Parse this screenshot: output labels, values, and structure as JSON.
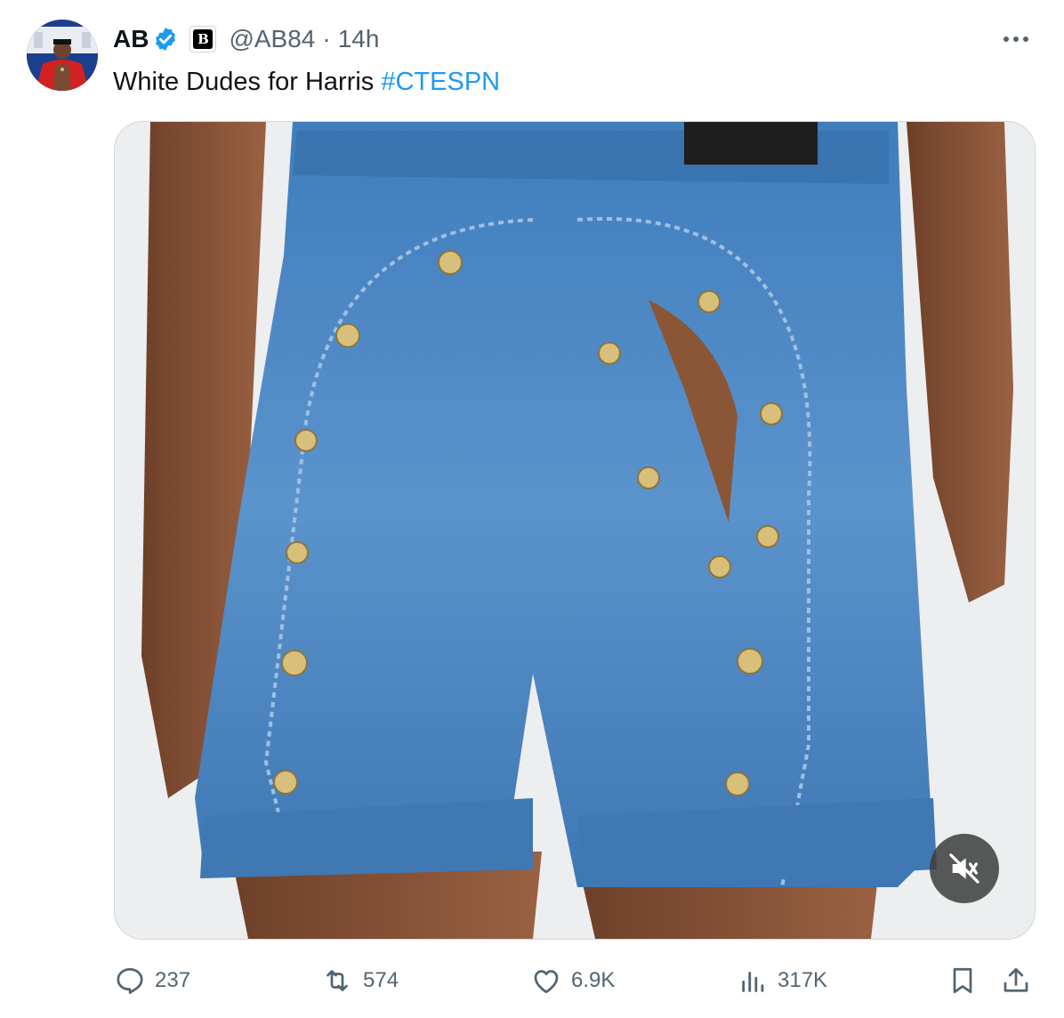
{
  "tweet": {
    "author": {
      "display_name": "AB",
      "handle": "@AB84",
      "separator": "·",
      "time": "14h",
      "avatar_icon": "avatar-image",
      "verified_icon": "verified-badge-icon",
      "affiliation_icon": "affiliation-badge-icon",
      "affiliation_label": "B"
    },
    "text": {
      "body": "White Dudes for Harris ",
      "hashtag": "#CTESPN"
    },
    "more_icon": "more-options-icon",
    "media": {
      "type": "video",
      "mute_icon": "muted-speaker-icon"
    },
    "actions": {
      "reply": {
        "icon": "reply-icon",
        "count": "237"
      },
      "repost": {
        "icon": "repost-icon",
        "count": "574"
      },
      "like": {
        "icon": "heart-icon",
        "count": "6.9K"
      },
      "views": {
        "icon": "views-icon",
        "count": "317K"
      },
      "bookmark": {
        "icon": "bookmark-icon"
      },
      "share": {
        "icon": "share-icon"
      }
    }
  },
  "colors": {
    "text": "#0f1419",
    "secondary": "#536471",
    "link": "#1d9bf0",
    "verified": "#1d9bf0",
    "border": "#cfd9de"
  }
}
